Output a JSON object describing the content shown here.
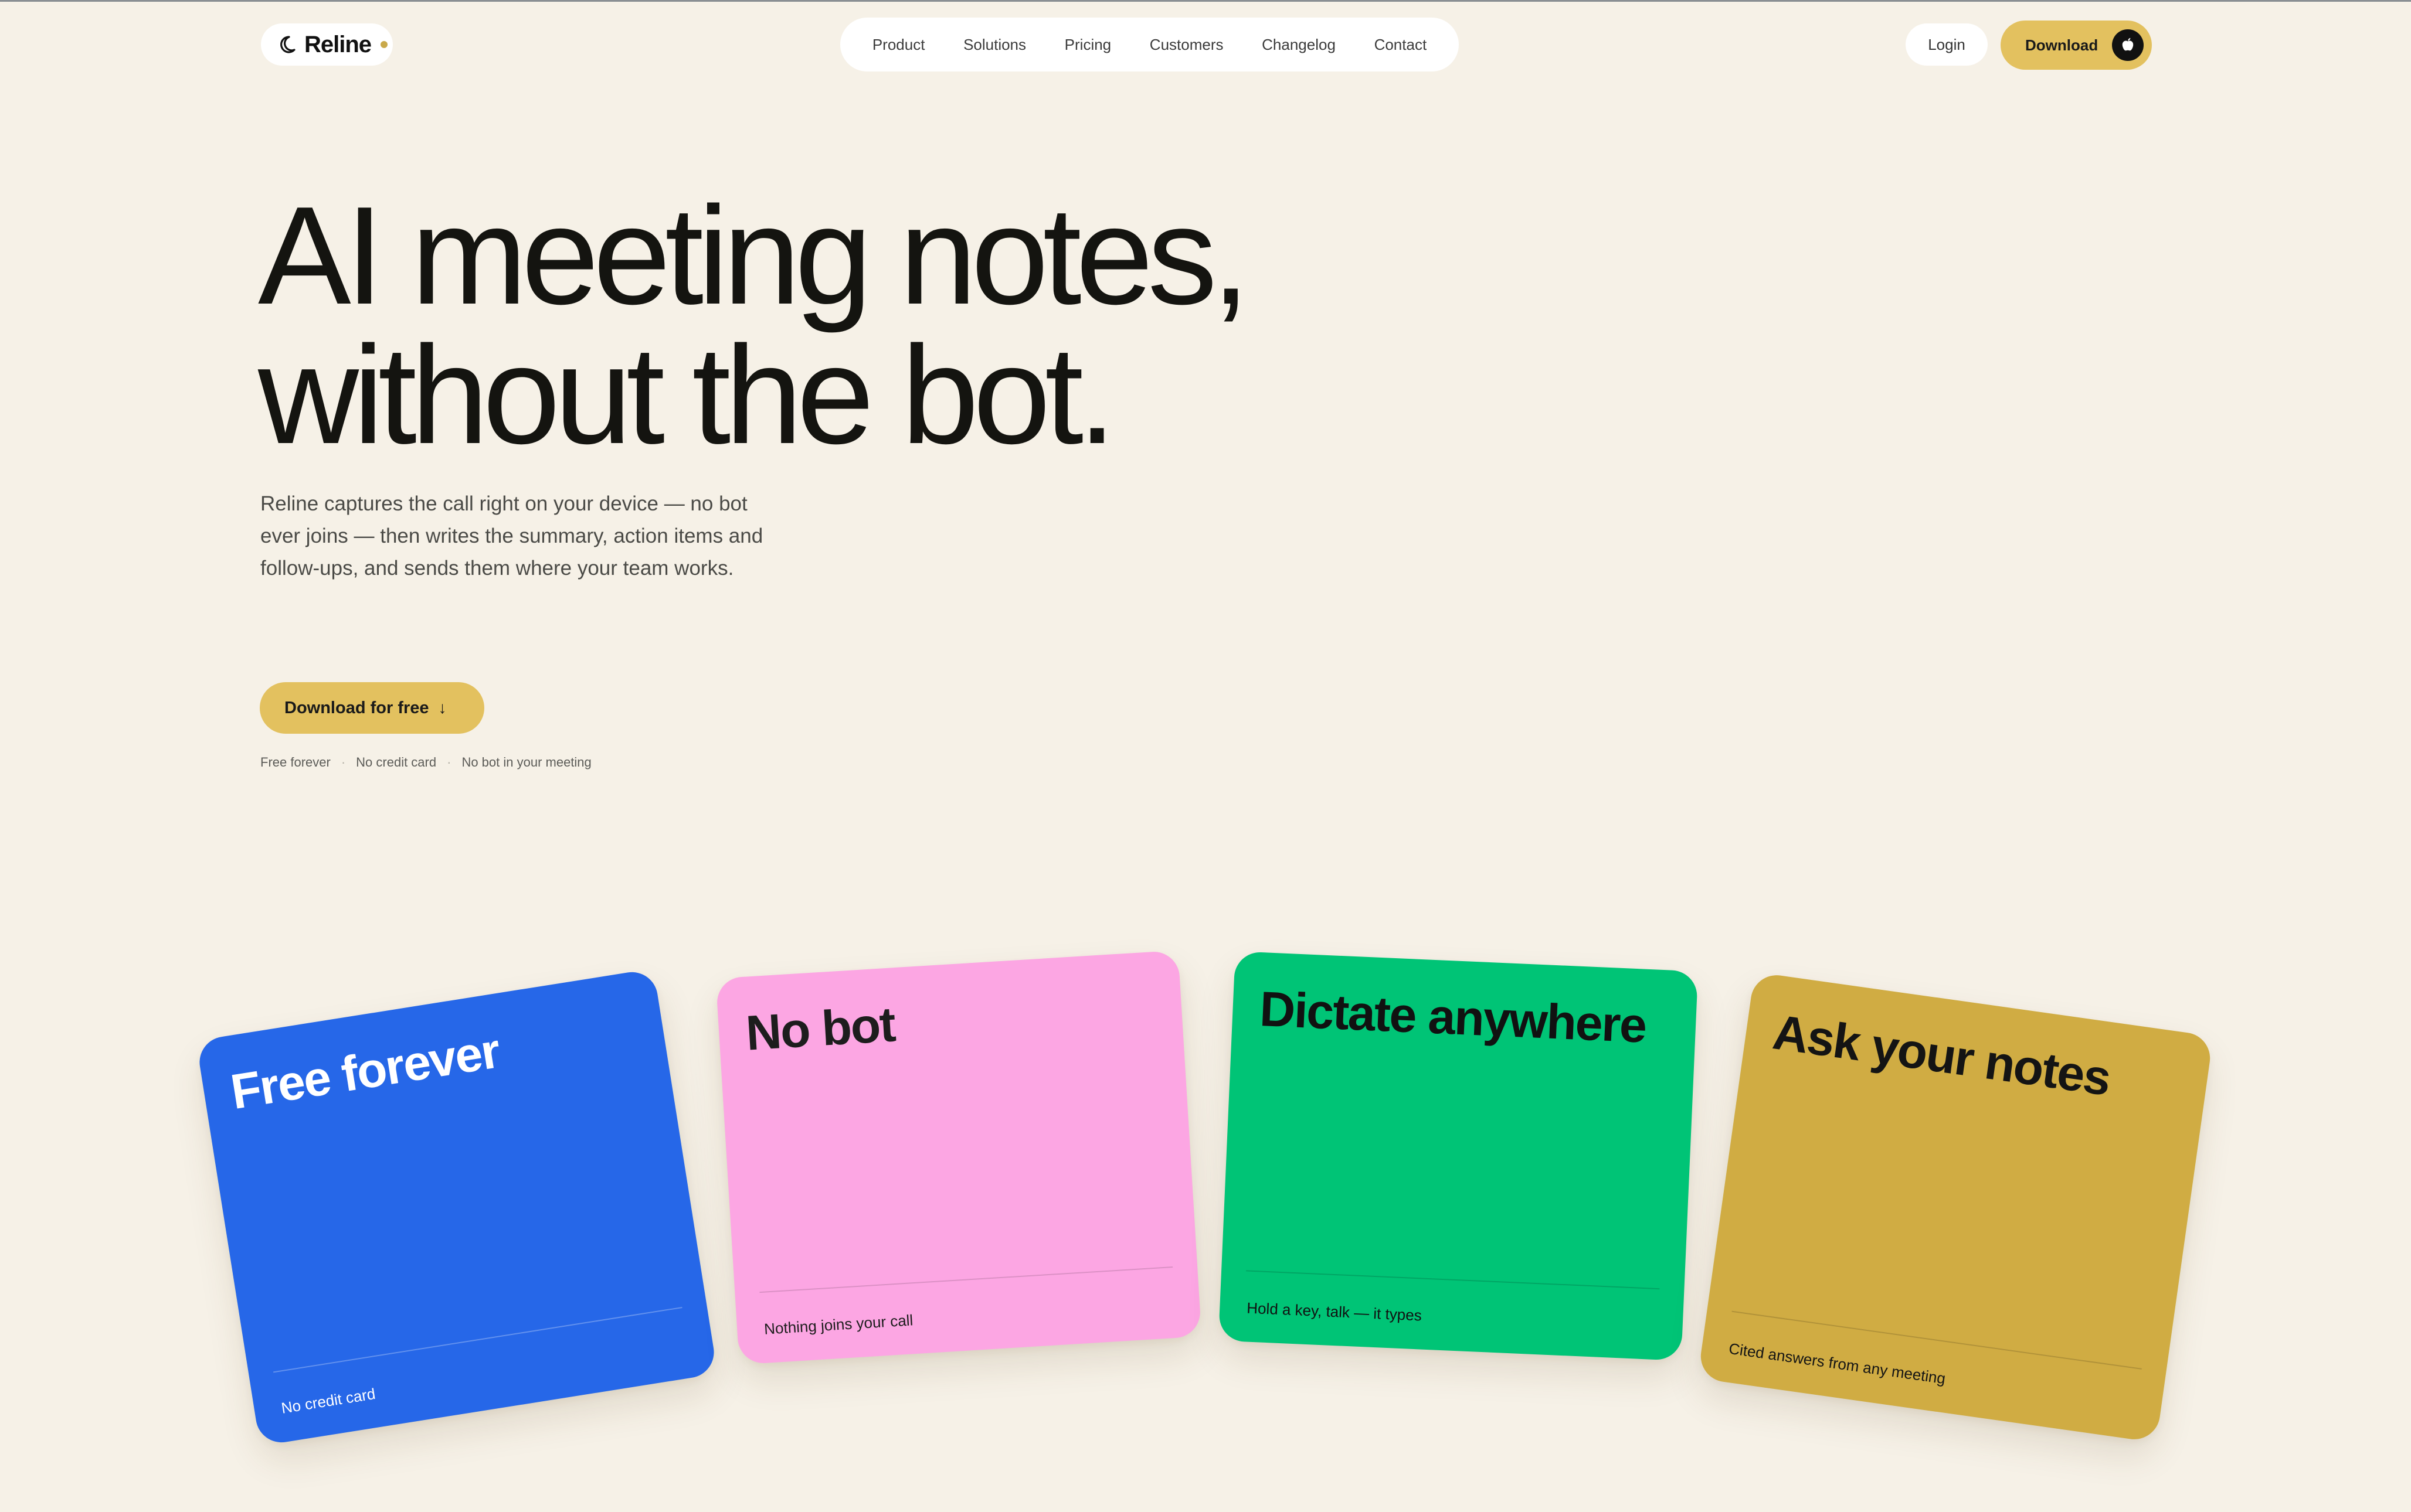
{
  "brand": {
    "name": "Reline",
    "icon": "crescent-moon-icon",
    "accent": "#e3c15f",
    "dot_color": "#c9a94a"
  },
  "nav": {
    "links": [
      "Product",
      "Solutions",
      "Pricing",
      "Customers",
      "Changelog",
      "Contact"
    ]
  },
  "header": {
    "login_label": "Login",
    "download_label": "Download",
    "download_icon": "apple-icon"
  },
  "hero": {
    "title_line1": "AI meeting notes,",
    "title_line2": "without the bot.",
    "subtitle": "Reline captures the call right on your device — no bot ever joins — then writes the summary, action items and follow-ups, and sends them where your team works.",
    "cta_label": "Download for free",
    "cta_icon": "arrow-down-icon",
    "perks": [
      "Free forever",
      "No credit card",
      "No bot in your meeting"
    ],
    "perk_separator": "·"
  },
  "cards": [
    {
      "title": "Free forever",
      "footer": "No credit card",
      "color": "#2667e8"
    },
    {
      "title": "No bot",
      "footer": "Nothing joins your call",
      "color": "#fca6e3"
    },
    {
      "title": "Dictate anywhere",
      "footer": "Hold a key, talk — it types",
      "color": "#00c476"
    },
    {
      "title": "Ask your notes",
      "footer": "Cited answers from any meeting",
      "color": "#d0ac43"
    }
  ]
}
